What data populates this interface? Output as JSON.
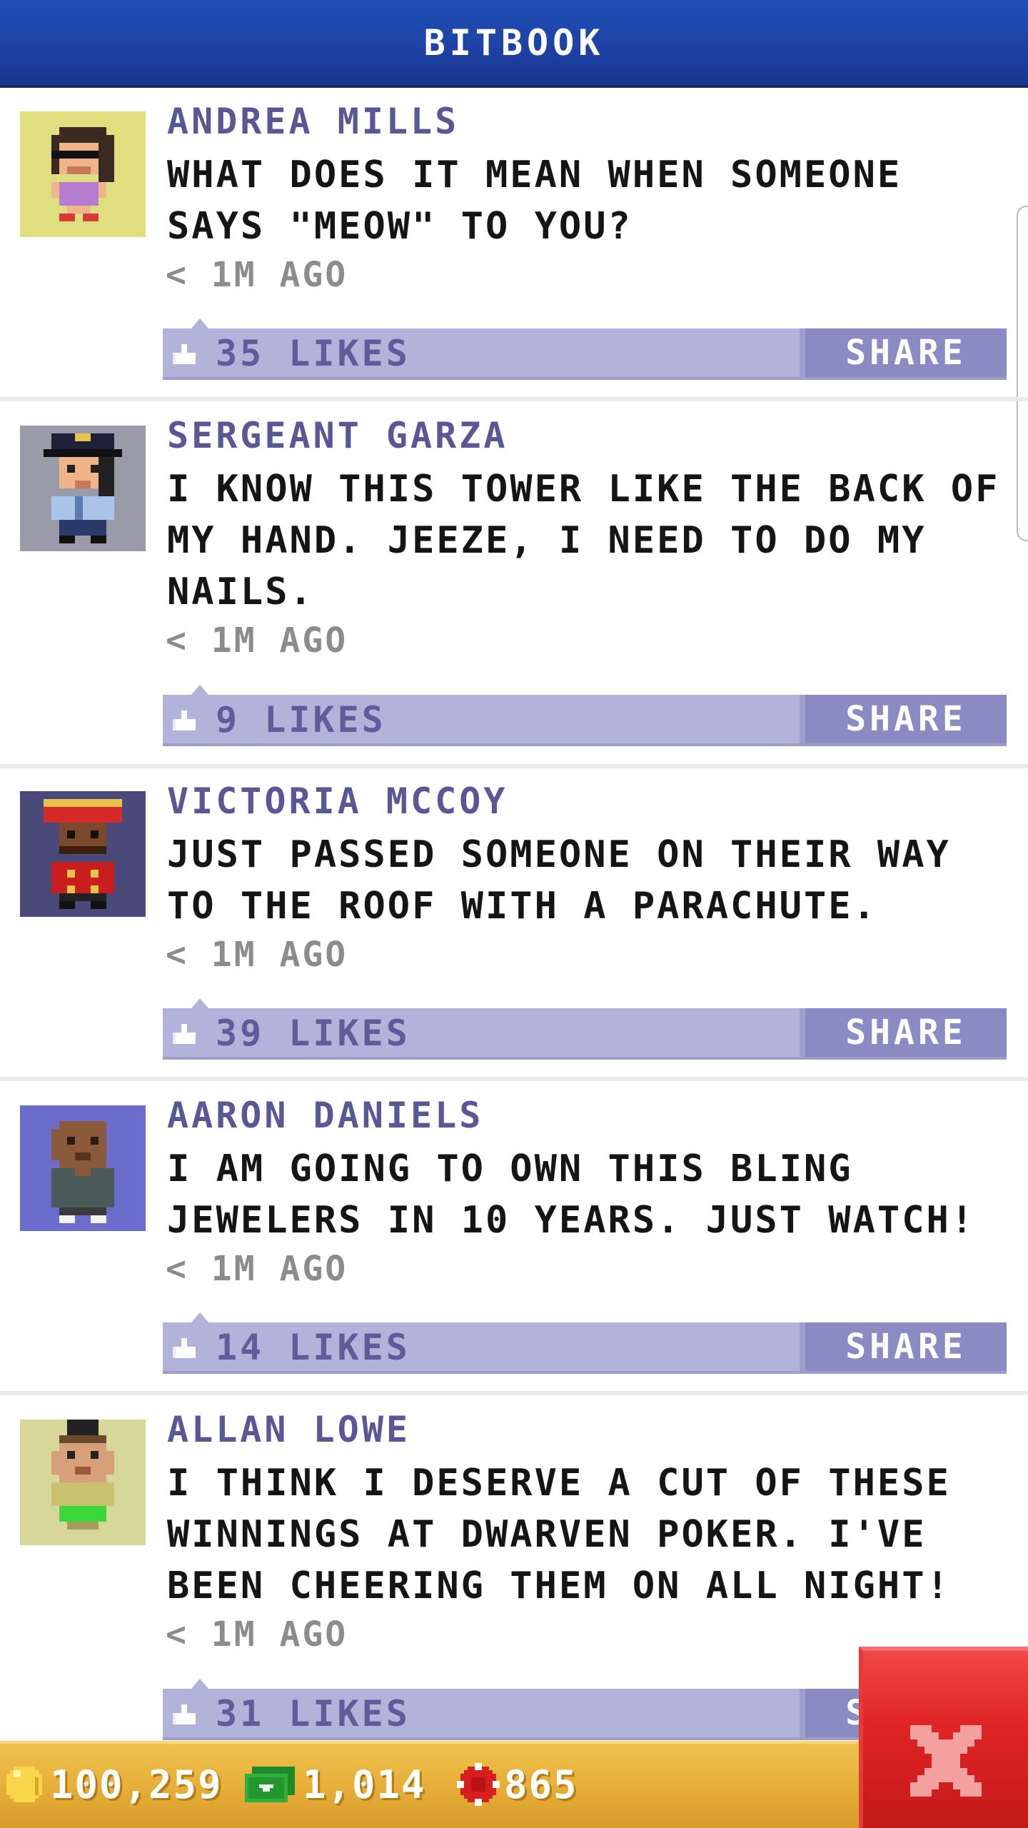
{
  "header": {
    "title": "BITBOOK"
  },
  "posts": [
    {
      "name": "ANDREA MILLS",
      "lines": [
        "WHAT DOES IT MEAN WHEN SOMEONE",
        "SAYS \"MEOW\" TO YOU?"
      ],
      "time": "< 1M AGO",
      "likes": "35 LIKES",
      "share": "SHARE",
      "avatar_bg": "#dfdf80"
    },
    {
      "name": "SERGEANT GARZA",
      "lines": [
        "I KNOW THIS TOWER LIKE THE BACK OF",
        "MY HAND. JEEZE, I NEED TO DO MY",
        "NAILS."
      ],
      "time": "< 1M AGO",
      "likes": "9 LIKES",
      "share": "SHARE",
      "avatar_bg": "#9b9aa8"
    },
    {
      "name": "VICTORIA MCCOY",
      "lines": [
        "JUST PASSED SOMEONE ON THEIR WAY",
        "TO THE ROOF WITH A PARACHUTE."
      ],
      "time": "< 1M AGO",
      "likes": "39 LIKES",
      "share": "SHARE",
      "avatar_bg": "#4a4a7a"
    },
    {
      "name": "AARON DANIELS",
      "lines": [
        "I AM GOING TO OWN THIS BLING",
        "JEWELERS IN 10 YEARS. JUST WATCH!"
      ],
      "time": "< 1M AGO",
      "likes": "14 LIKES",
      "share": "SHARE",
      "avatar_bg": "#6c6ccc"
    },
    {
      "name": "ALLAN LOWE",
      "lines": [
        "I THINK I DESERVE A CUT OF THESE",
        "WINNINGS AT DWARVEN POKER. I'VE",
        "BEEN CHEERING THEM ON ALL NIGHT!"
      ],
      "time": "< 1M AGO",
      "likes": "31 LIKES",
      "share": "SHARE",
      "avatar_bg": "#d7d799"
    }
  ],
  "status": {
    "coins": "100,259",
    "bux": "1,014",
    "chips": "865"
  },
  "colors": {
    "header": "#1d3f9f",
    "name": "#5a5796",
    "likebar": "#b2b3da",
    "share_button": "#8a8bc2",
    "statusbar": "#e7b13a",
    "close_button": "#e02525"
  },
  "icons": {
    "like": "thumbs-up-icon",
    "coin": "coin-icon",
    "bux": "bux-icon",
    "chip": "chip-icon",
    "close": "close-icon"
  }
}
